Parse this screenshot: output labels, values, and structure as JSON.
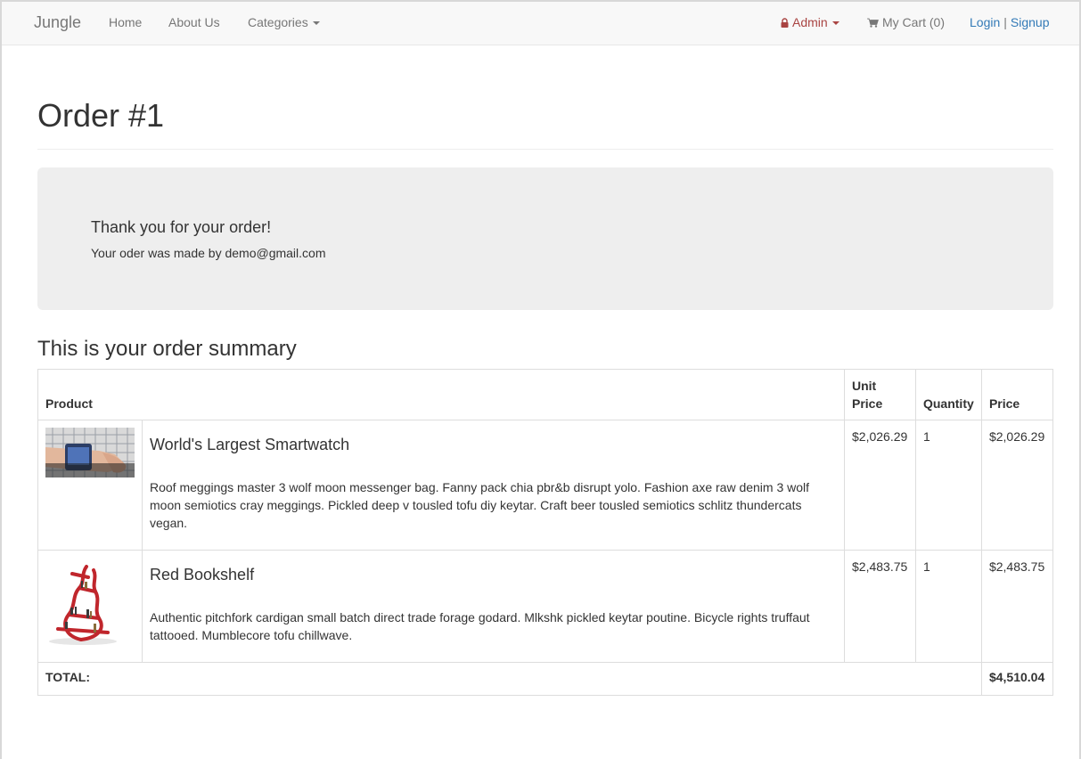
{
  "nav": {
    "brand": "Jungle",
    "home": "Home",
    "about": "About Us",
    "categories": "Categories",
    "admin": "Admin",
    "cart": "My Cart (0)",
    "login": "Login",
    "separator": "|",
    "signup": "Signup"
  },
  "page": {
    "title": "Order #1"
  },
  "thanks": {
    "title": "Thank you for your order!",
    "subtitle": "Your oder was made by demo@gmail.com"
  },
  "summary": {
    "title": "This is your order summary",
    "headers": {
      "product": "Product",
      "unit_price": "Unit Price",
      "quantity": "Quantity",
      "price": "Price"
    },
    "items": [
      {
        "name": "World's Largest Smartwatch",
        "description": "Roof meggings master 3 wolf moon messenger bag. Fanny pack chia pbr&b disrupt yolo. Fashion axe raw denim 3 wolf moon semiotics cray meggings. Pickled deep v tousled tofu diy keytar. Craft beer tousled semiotics schlitz thundercats vegan.",
        "unit_price": "$2,026.29",
        "quantity": "1",
        "price": "$2,026.29"
      },
      {
        "name": "Red Bookshelf",
        "description": "Authentic pitchfork cardigan small batch direct trade forage godard. Mlkshk pickled keytar poutine. Bicycle rights truffaut tattooed. Mumblecore tofu chillwave.",
        "unit_price": "$2,483.75",
        "quantity": "1",
        "price": "$2,483.75"
      }
    ],
    "total_label": "TOTAL:",
    "total_value": "$4,510.04"
  },
  "colors": {
    "admin": "#a94442",
    "link": "#337ab7",
    "nav_bg": "#f8f8f8",
    "panel_bg": "#eeeeee"
  }
}
